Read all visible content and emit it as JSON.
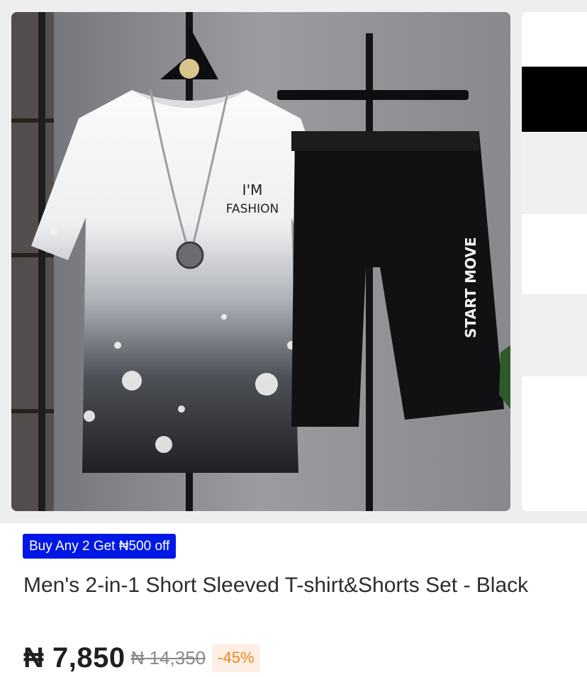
{
  "product": {
    "image_alt": "Men's 2-in-1 Short Sleeved T-shirt&Shorts Set - Black",
    "tshirt_print_line1": "I'M",
    "tshirt_print_line2": "FASHION",
    "shorts_print": "START MOVE",
    "promo_label": "Buy Any 2 Get ₦500 off",
    "title": "Men's 2-in-1 Short Sleeved T-shirt&Shorts Set - Black",
    "price": "₦ 7,850",
    "old_price": "₦ 14,350",
    "discount": "-45%"
  },
  "colors": {
    "promo_bg": "#0018e6",
    "discount_text": "#f6851f",
    "discount_bg": "#feefe4"
  }
}
